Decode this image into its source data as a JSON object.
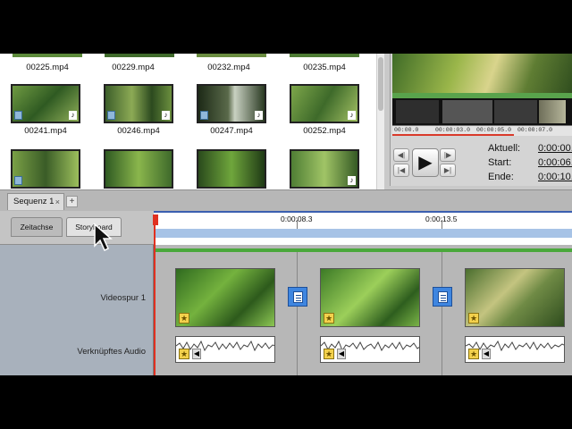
{
  "media_browser": {
    "rows": [
      [
        {
          "name": "00225.mp4"
        },
        {
          "name": "00229.mp4"
        },
        {
          "name": "00232.mp4"
        },
        {
          "name": "00235.mp4"
        }
      ],
      [
        {
          "name": "00241.mp4"
        },
        {
          "name": "00246.mp4"
        },
        {
          "name": "00247.mp4"
        },
        {
          "name": "00252.mp4"
        }
      ]
    ]
  },
  "preview": {
    "ruler_ticks": [
      "00:00.0",
      "00:00:03.0",
      "00:00:05.0",
      "00:00:07.0"
    ],
    "labels": {
      "current": "Aktuell:",
      "start": "Start:",
      "end": "Ende:"
    },
    "values": {
      "current": "0:00:00.",
      "start": "0:00:06.",
      "end": "0:00:10."
    },
    "icons": {
      "prev_frame": "step-back-icon",
      "next_frame": "step-forward-icon",
      "go_start": "go-to-start-icon",
      "go_end": "go-to-end-icon",
      "play": "play-icon"
    }
  },
  "sequence": {
    "tab_label": "Sequenz 1",
    "close_symbol": "×",
    "add_symbol": "+"
  },
  "timeline": {
    "mode_tabs": [
      "Zeitachse",
      "Storyboard"
    ],
    "active_mode": "Storyboard",
    "ruler_labels": [
      "0:00:08.3",
      "0:00:13.5"
    ],
    "tracks": {
      "video": "Videospur 1",
      "audio": "Verknüpftes Audio"
    }
  },
  "colors": {
    "playhead": "#e03020",
    "ruler_band": "#a7c3e6",
    "transition": "#3f86e0",
    "track_green": "#4aa83b"
  }
}
